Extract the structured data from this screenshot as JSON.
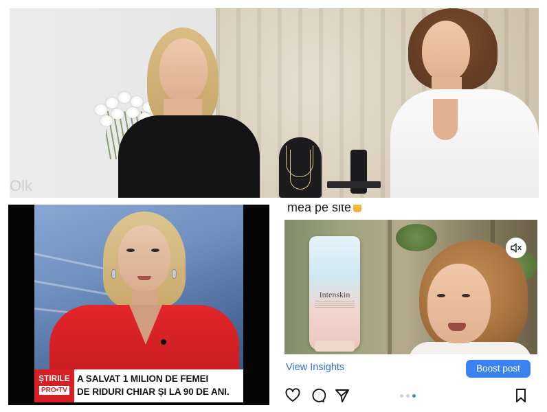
{
  "top_panel": {
    "watermark_text": "Olk"
  },
  "news_panel": {
    "logo_line1": "ȘTIRILE",
    "logo_line2": "PRO•TV",
    "headline_line1": "A SALVAT 1 MILION DE FEMEI",
    "headline_line2": "DE RIDURI CHIAR ȘI LA 90 DE ANI."
  },
  "instagram_panel": {
    "caption_partial": "mea pe site",
    "product_brand": "Intenskin",
    "view_insights_label": "View Insights",
    "boost_post_label": "Boost post",
    "icons": [
      "speaker-mute-icon",
      "heart-icon",
      "comment-icon",
      "share-icon",
      "bookmark-icon"
    ],
    "accent_color": "#3b82f1",
    "link_color": "#2f6ee0"
  },
  "colors": {
    "news_red": "#d71f26",
    "jacket_red": "#e3262a"
  }
}
